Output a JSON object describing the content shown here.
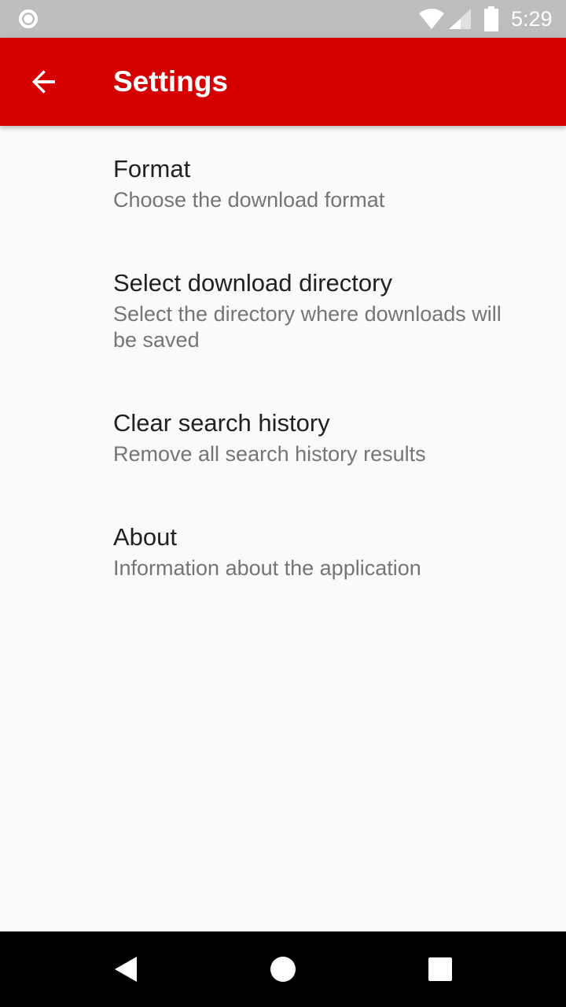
{
  "status_bar": {
    "time": "5:29",
    "icons": [
      "notification-circle-icon",
      "wifi-icon",
      "signal-icon",
      "battery-icon"
    ]
  },
  "app_bar": {
    "title": "Settings",
    "back_icon": "arrow-back-icon",
    "color": "#d50000"
  },
  "preferences": [
    {
      "title": "Format",
      "summary": "Choose the download format"
    },
    {
      "title": "Select download directory",
      "summary": "Select the directory where downloads will be saved"
    },
    {
      "title": "Clear search history",
      "summary": "Remove all search history results"
    },
    {
      "title": "About",
      "summary": "Information about the application"
    }
  ],
  "nav_bar": {
    "icons": [
      "back-triangle-icon",
      "home-circle-icon",
      "recents-square-icon"
    ]
  }
}
